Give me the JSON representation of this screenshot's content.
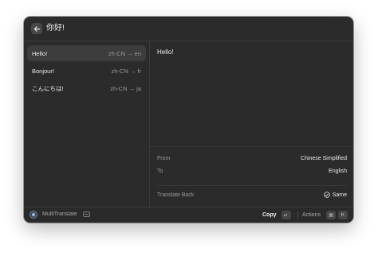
{
  "header": {
    "query": "你好!",
    "back_icon": "arrow-left-icon"
  },
  "translations": [
    {
      "label": "Hello!",
      "direction": "zh-CN → en",
      "selected": true
    },
    {
      "label": "Bonjour!",
      "direction": "zh-CN → fr",
      "selected": false
    },
    {
      "label": "こんにちは!",
      "direction": "zh-CN → ja",
      "selected": false
    }
  ],
  "detail": {
    "output": "Hello!",
    "from_label": "From",
    "from_value": "Chinese Simplified",
    "to_label": "To",
    "to_value": "English",
    "translate_back_label": "Translate Back",
    "translate_back_value": "Same"
  },
  "footer": {
    "app_name": "MultiTranslate",
    "primary_action": "Copy",
    "primary_key": "↵",
    "actions_label": "Actions",
    "actions_keys": [
      "⌘",
      "K"
    ]
  }
}
